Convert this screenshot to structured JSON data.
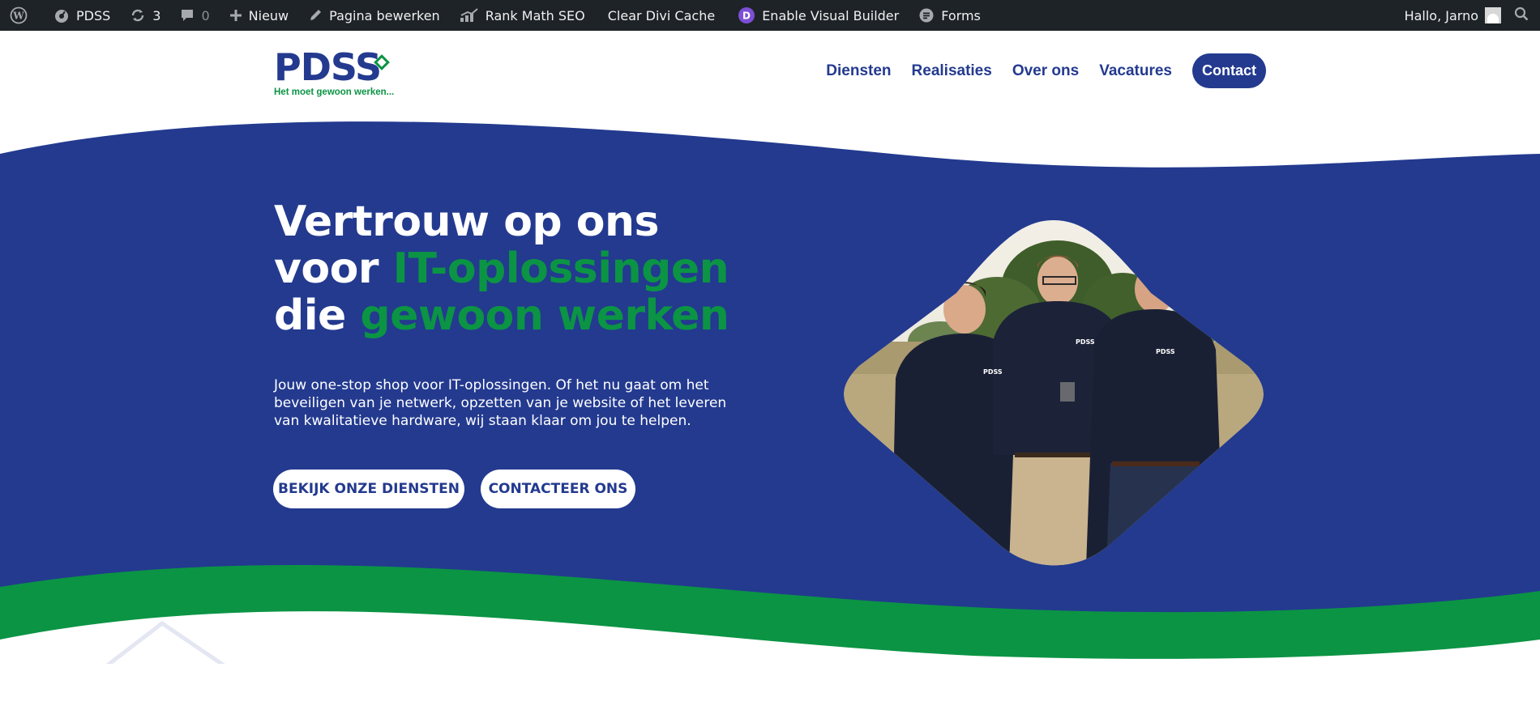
{
  "adminbar": {
    "site_name": "PDSS",
    "updates_count": "3",
    "comments_count": "0",
    "new_label": "Nieuw",
    "edit_label": "Pagina bewerken",
    "rankmath_label": "Rank Math SEO",
    "cache_label": "Clear Divi Cache",
    "divi_label": "Enable Visual Builder",
    "forms_label": "Forms",
    "greeting": "Hallo, Jarno"
  },
  "header": {
    "logo_text": "PDSS",
    "logo_tagline": "Het moet gewoon werken...",
    "nav": [
      "Diensten",
      "Realisaties",
      "Over ons",
      "Vacatures"
    ],
    "cta": "Contact"
  },
  "hero": {
    "title_line1": "Vertrouw op ons",
    "title_line2_a": "voor ",
    "title_line2_b": "IT-oplossingen",
    "title_line3_a": "die ",
    "title_line3_b": "gewoon werken",
    "text": "Jouw one-stop shop voor IT-oplossingen. Of het nu gaat om het beveiligen van je netwerk, opzetten van je website of het leveren van kwalitatieve hardware, wij staan klaar om jou te helpen.",
    "button_primary": "BEKIJK ONZE DIENSTEN",
    "button_secondary": "CONTACTEER ONS",
    "shirt_logo": "PDSS"
  },
  "colors": {
    "brand_blue": "#233a8f",
    "brand_green": "#0b9444",
    "adminbar_bg": "#1d2327"
  }
}
